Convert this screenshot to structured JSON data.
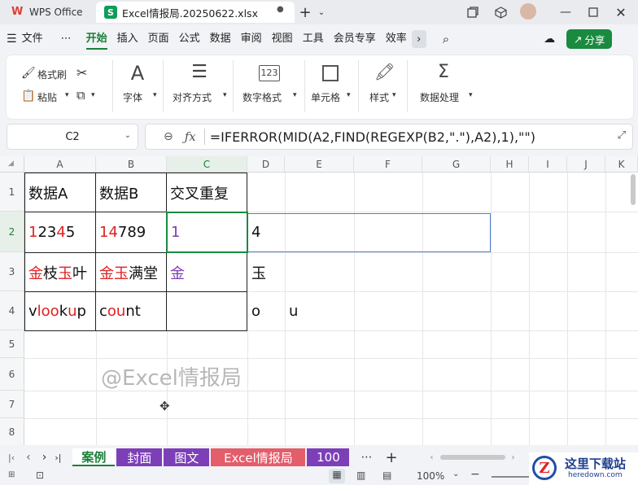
{
  "titlebar": {
    "app_name": "WPS Office",
    "doc_tab": "Excel情报局.20250622.xlsx",
    "doc_icon": "S"
  },
  "menu": {
    "file": "文件",
    "more": "⋯",
    "items": [
      "开始",
      "插入",
      "页面",
      "公式",
      "数据",
      "审阅",
      "视图",
      "工具",
      "会员专享",
      "效率"
    ],
    "share": "分享"
  },
  "ribbon": {
    "format_painter": "格式刷",
    "paste": "粘贴",
    "font": "字体",
    "align": "对齐方式",
    "number_format": "数字格式",
    "cell": "单元格",
    "style": "样式",
    "data_process": "数据处理"
  },
  "formula_bar": {
    "name_box": "C2",
    "formula": "=IFERROR(MID(A2,FIND(REGEXP(B2,\".\"),A2),1),\"\")"
  },
  "columns": [
    "A",
    "B",
    "C",
    "D",
    "E",
    "F",
    "G",
    "H",
    "I",
    "J",
    "K"
  ],
  "rows": [
    "1",
    "2",
    "3",
    "4",
    "5",
    "6",
    "7",
    "8"
  ],
  "cells": {
    "A1": "数据A",
    "B1": "数据B",
    "C1": "交叉重复",
    "A2_parts": [
      "1",
      "2",
      "3",
      "4",
      "5"
    ],
    "B2_parts": [
      "14",
      "789"
    ],
    "C2": "1",
    "D2": "4",
    "A3_parts": [
      "金",
      "枝",
      "玉",
      "叶"
    ],
    "B3_parts": [
      "金玉",
      "满堂"
    ],
    "C3": "金",
    "D3": "玉",
    "A4_parts": [
      "v",
      "loo",
      "k",
      "u",
      "p"
    ],
    "B4_parts": [
      "c",
      "ou",
      "nt"
    ],
    "D4": "o",
    "E4": "u"
  },
  "watermark": "@Excel情报局",
  "sheets": [
    "案例",
    "封面",
    "图文",
    "Excel情报局",
    "100"
  ],
  "sheet_colors": [
    "#ffffff",
    "#7d3fb8",
    "#7d3fb8",
    "#e35d6a",
    "#7d3fb8"
  ],
  "status": {
    "zoom": "100%"
  },
  "site_logo": {
    "name": "这里下载站",
    "url": "heredown.com"
  },
  "colors": {
    "accent": "#1a7f37",
    "highlight_red": "#e02020",
    "result_purple": "#7b3fb0"
  }
}
